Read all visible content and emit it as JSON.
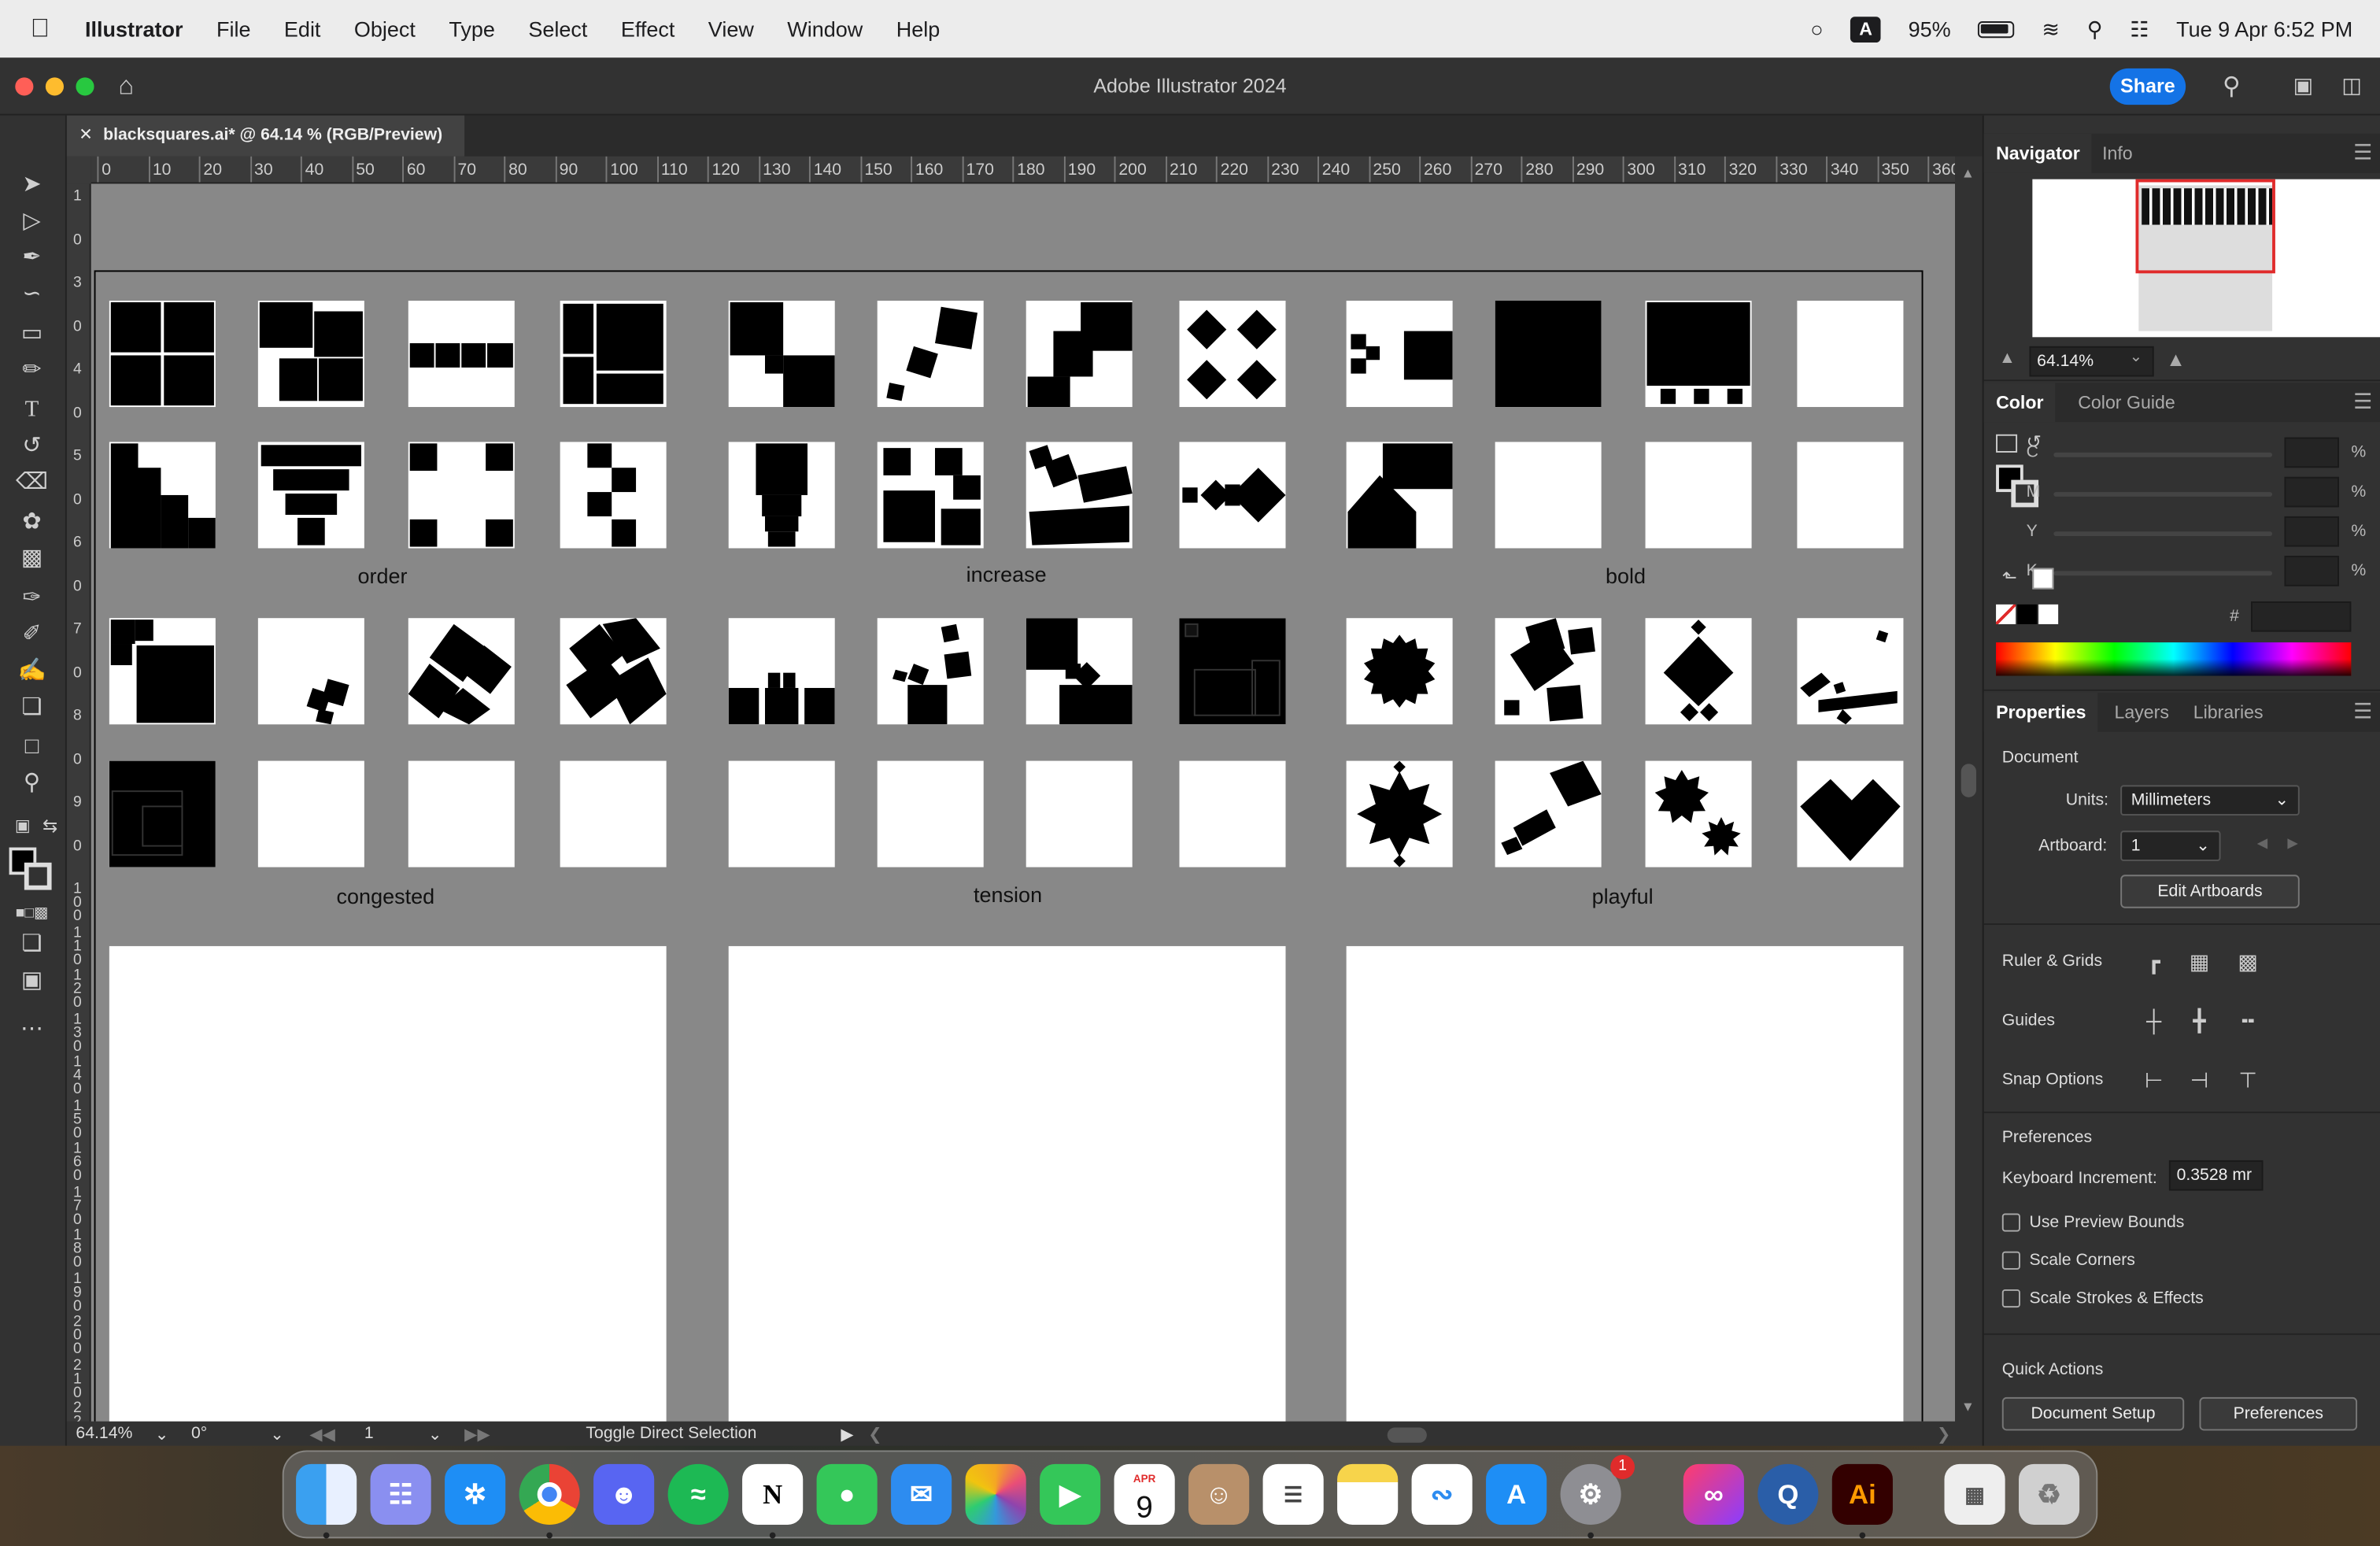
{
  "menubar": {
    "app": "Illustrator",
    "items": [
      "File",
      "Edit",
      "Object",
      "Type",
      "Select",
      "Effect",
      "View",
      "Window",
      "Help"
    ],
    "battery": "95%",
    "datetime": "Tue 9 Apr  6:52 PM",
    "input_source": "A"
  },
  "window": {
    "title": "Adobe Illustrator 2024",
    "share_label": "Share"
  },
  "document_tab": {
    "label": "blacksquares.ai* @ 64.14 % (RGB/Preview)"
  },
  "ruler": {
    "h_ticks": [
      "0",
      "10",
      "20",
      "30",
      "40",
      "50",
      "60",
      "70",
      "80",
      "90",
      "100",
      "110",
      "120",
      "130",
      "140",
      "150",
      "160",
      "170",
      "180",
      "190",
      "200",
      "210",
      "220",
      "230",
      "240",
      "250",
      "260",
      "270",
      "280",
      "290",
      "300",
      "310",
      "320",
      "330",
      "340",
      "350",
      "360"
    ],
    "v_ticks": [
      "1",
      "0",
      "3",
      "0",
      "4",
      "0",
      "5",
      "0",
      "6",
      "0",
      "7",
      "0",
      "8",
      "0",
      "9",
      "0",
      "1\n0\n0",
      "1\n1\n0",
      "1\n2\n0",
      "1\n3\n0",
      "1\n4\n0",
      "1\n5\n0",
      "1\n6\n0",
      "1\n7\n0",
      "1\n8\n0",
      "1\n9\n0",
      "2\n0\n0",
      "2\n1\n0",
      "2\n2\n0"
    ]
  },
  "canvas": {
    "labels": {
      "order": "order",
      "increase": "increase",
      "bold": "bold",
      "congested": "congested",
      "tension": "tension",
      "playful": "playful"
    }
  },
  "status": {
    "zoom": "64.14%",
    "rotation": "0°",
    "artboard": "1",
    "tool": "Toggle Direct Selection"
  },
  "navigator": {
    "tabs": [
      "Navigator",
      "Info"
    ],
    "zoom": "64.14%"
  },
  "color": {
    "tabs": [
      "Color",
      "Color Guide"
    ],
    "channels": [
      "C",
      "M",
      "Y",
      "K"
    ],
    "unit": "%",
    "hex_label": "#"
  },
  "properties": {
    "tabs": [
      "Properties",
      "Layers",
      "Libraries"
    ],
    "section": "Document",
    "units_label": "Units:",
    "units_value": "Millimeters",
    "artboard_label": "Artboard:",
    "artboard_value": "1",
    "edit_artboards": "Edit Artboards",
    "ruler_grids": "Ruler & Grids",
    "guides": "Guides",
    "snap_options": "Snap Options",
    "preferences_header": "Preferences",
    "keyboard_increment_label": "Keyboard Increment:",
    "keyboard_increment_value": "0.3528 mr",
    "checkboxes": [
      "Use Preview Bounds",
      "Scale Corners",
      "Scale Strokes & Effects"
    ],
    "quick_actions": "Quick Actions",
    "document_setup": "Document Setup",
    "preferences_btn": "Preferences"
  },
  "dock": {
    "calendar_month": "APR",
    "calendar_day": "9",
    "settings_badge": "1",
    "apps": [
      "Finder",
      "Launchpad",
      "Safari",
      "Chrome",
      "Discord",
      "Spotify",
      "Notion",
      "Messages",
      "Mail",
      "Photos",
      "FaceTime",
      "Calendar",
      "Contacts",
      "Reminders",
      "Notes",
      "Freeform",
      "App Store",
      "System Settings",
      "Creative Cloud",
      "QuickTime",
      "Illustrator",
      "Numbers",
      "Trash"
    ]
  },
  "colors": {
    "accent": "#1473e6",
    "canvas": "#888888",
    "panel": "#323232"
  }
}
